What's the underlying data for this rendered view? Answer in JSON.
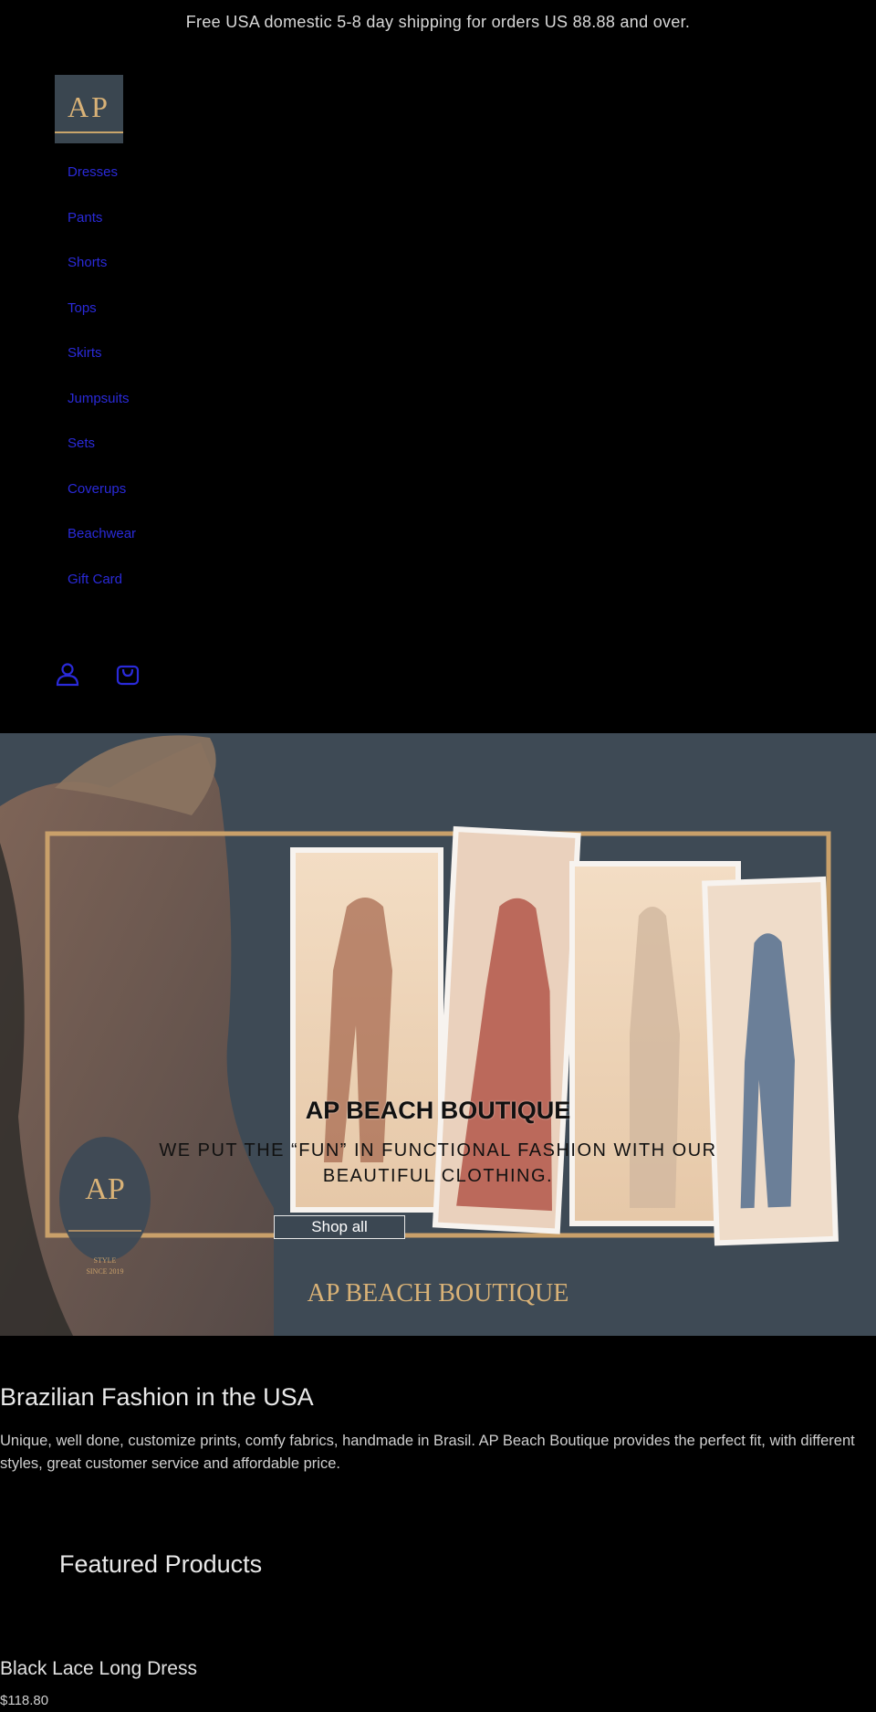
{
  "announcement": "Free USA domestic 5-8 day shipping for orders US 88.88 and over.",
  "logo": {
    "text": "AP"
  },
  "nav": {
    "items": [
      {
        "label": "Dresses"
      },
      {
        "label": "Pants"
      },
      {
        "label": "Shorts"
      },
      {
        "label": "Tops"
      },
      {
        "label": "Skirts"
      },
      {
        "label": "Jumpsuits"
      },
      {
        "label": "Sets"
      },
      {
        "label": "Coverups"
      },
      {
        "label": "Beachwear"
      },
      {
        "label": "Gift Card"
      }
    ]
  },
  "icons": {
    "account": "account-icon",
    "cart": "cart-icon"
  },
  "hero": {
    "title": "AP BEACH BOUTIQUE",
    "subtitle": "WE PUT THE “FUN” IN FUNCTIONAL FASHION WITH OUR BEAUTIFUL CLOTHING.",
    "button_label": "Shop all",
    "art_brand": "AP BEACH BOUTIQUE",
    "art_logo": "AP",
    "art_tagline_1": "STYLE",
    "art_tagline_2": "SINCE 2019"
  },
  "intro": {
    "heading": "Brazilian Fashion in the USA",
    "body": "Unique, well done, customize prints, comfy fabrics, handmade in Brasil. AP Beach Boutique provides the perfect fit, with different styles, great customer service and affordable price."
  },
  "featured": {
    "title": "Featured Products",
    "products": [
      {
        "name": "Black Lace Long Dress",
        "price": "$118.80"
      }
    ]
  },
  "colors": {
    "background": "#000000",
    "nav_link": "#2a2ad9",
    "hero_bg": "#3e4a55",
    "gold": "#d9b277"
  }
}
